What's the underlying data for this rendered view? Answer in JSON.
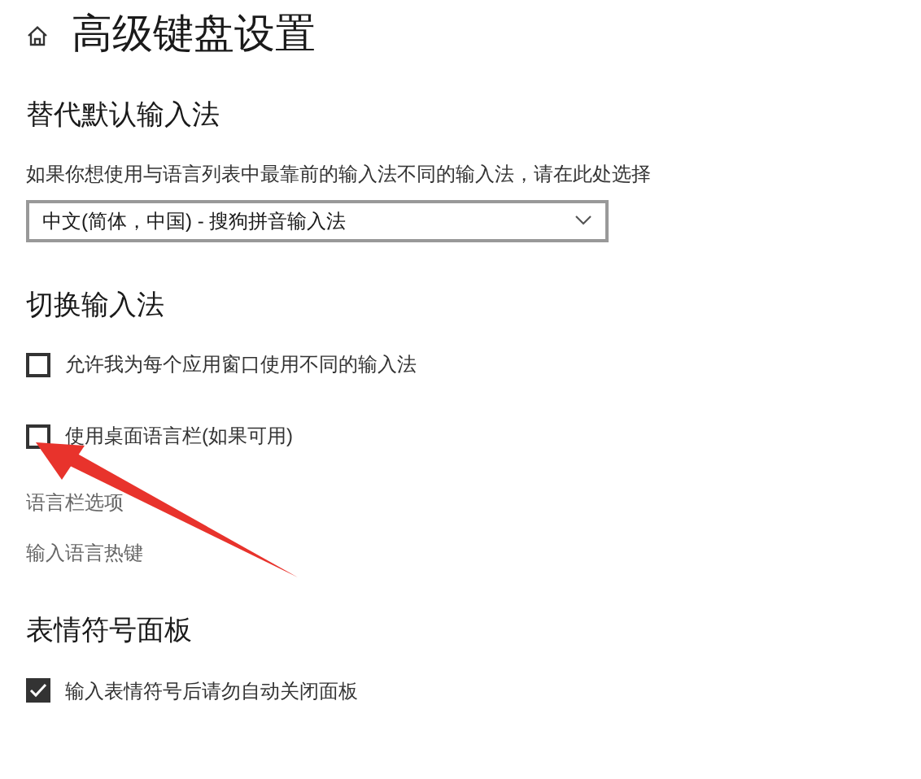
{
  "page": {
    "title": "高级键盘设置"
  },
  "sections": [
    {
      "heading": "替代默认输入法",
      "items": [
        {
          "kind": "description",
          "text": "如果你想使用与语言列表中最靠前的输入法不同的输入法，请在此处选择"
        },
        {
          "kind": "dropdown",
          "value": "中文(简体，中国) - 搜狗拼音输入法"
        }
      ]
    },
    {
      "heading": "切换输入法",
      "items": [
        {
          "kind": "checkbox",
          "label": "允许我为每个应用窗口使用不同的输入法",
          "checked": false
        },
        {
          "kind": "checkbox",
          "label": "使用桌面语言栏(如果可用)",
          "checked": false
        },
        {
          "kind": "link",
          "text": "语言栏选项"
        },
        {
          "kind": "link",
          "text": "输入语言热键"
        }
      ]
    },
    {
      "heading": "表情符号面板",
      "items": [
        {
          "kind": "checkbox",
          "label": "输入表情符号后请勿自动关闭面板",
          "checked": true
        }
      ]
    }
  ]
}
